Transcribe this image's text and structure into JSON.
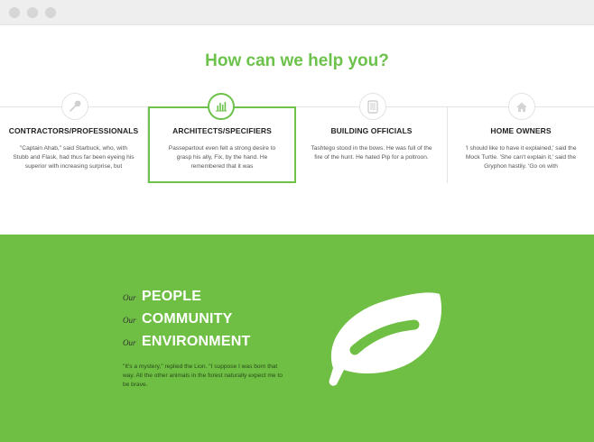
{
  "window": {
    "controls": [
      "close-dot",
      "minimize-dot",
      "maximize-dot"
    ]
  },
  "services": {
    "heading": "How can we help you?",
    "cards": [
      {
        "icon": "wrench-icon",
        "title": "CONTRACTORS/PROFESSIONALS",
        "text": "\"Captain Ahab,\" said Starbuck, who, with Stubb and Flask, had thus far been eyeing his superior with increasing surprise, but",
        "active": false
      },
      {
        "icon": "bar-chart-icon",
        "title": "ARCHITECTS/SPECIFIERS",
        "text": "Passepartout even felt a strong desire to grasp his ally, Fix, by the hand.  He remembered that it was",
        "active": true
      },
      {
        "icon": "tablet-icon",
        "title": "BUILDING OFFICIALS",
        "text": "Tashtego stood in the bows. He was full of the fire of the hunt. He hated Pip for a poltroon.",
        "active": false
      },
      {
        "icon": "home-icon",
        "title": "HOME OWNERS",
        "text": "'I should like to have it explained,' said the Mock Turtle. 'She can't explain it,' said the Gryphon hastily. 'Go on with",
        "active": false
      }
    ]
  },
  "mission": {
    "items": [
      {
        "prefix": "Our",
        "word": "PEOPLE"
      },
      {
        "prefix": "Our",
        "word": "COMMUNITY"
      },
      {
        "prefix": "Our",
        "word": "ENVIRONMENT"
      }
    ],
    "quote": "\"It's a mystery,\" replied the Lion.  \"I suppose I was born that way. All the other animals in the forest naturally expect me to be brave.",
    "icon": "leaf-icon"
  },
  "colors": {
    "accent": "#6cc24a",
    "band": "#6ebf43",
    "chrome": "#eeeeee"
  }
}
